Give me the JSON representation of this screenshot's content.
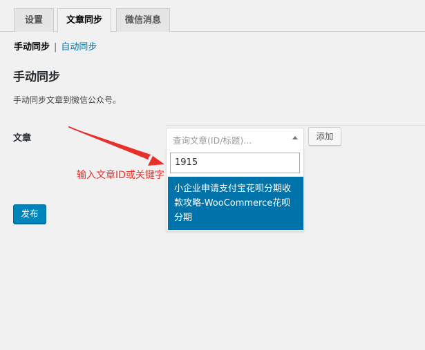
{
  "tabs": [
    {
      "label": "设置",
      "active": false
    },
    {
      "label": "文章同步",
      "active": true
    },
    {
      "label": "微信消息",
      "active": false
    }
  ],
  "subnav": {
    "current": "手动同步",
    "separator": "|",
    "link": "自动同步"
  },
  "section": {
    "title": "手动同步",
    "description": "手动同步文章到微信公众号。"
  },
  "form": {
    "article_label": "文章",
    "select_placeholder": "查询文章(ID/标题)...",
    "add_button": "添加",
    "search_value": "1915",
    "results": [
      "小企业申请支付宝花呗分期收款攻略-WooCommerce花呗分期"
    ]
  },
  "publish_button": "发布",
  "annotation": {
    "text": "输入文章ID或关键字",
    "color": "#e8302b"
  },
  "colors": {
    "accent": "#0073aa",
    "primary_button": "#0085ba"
  }
}
